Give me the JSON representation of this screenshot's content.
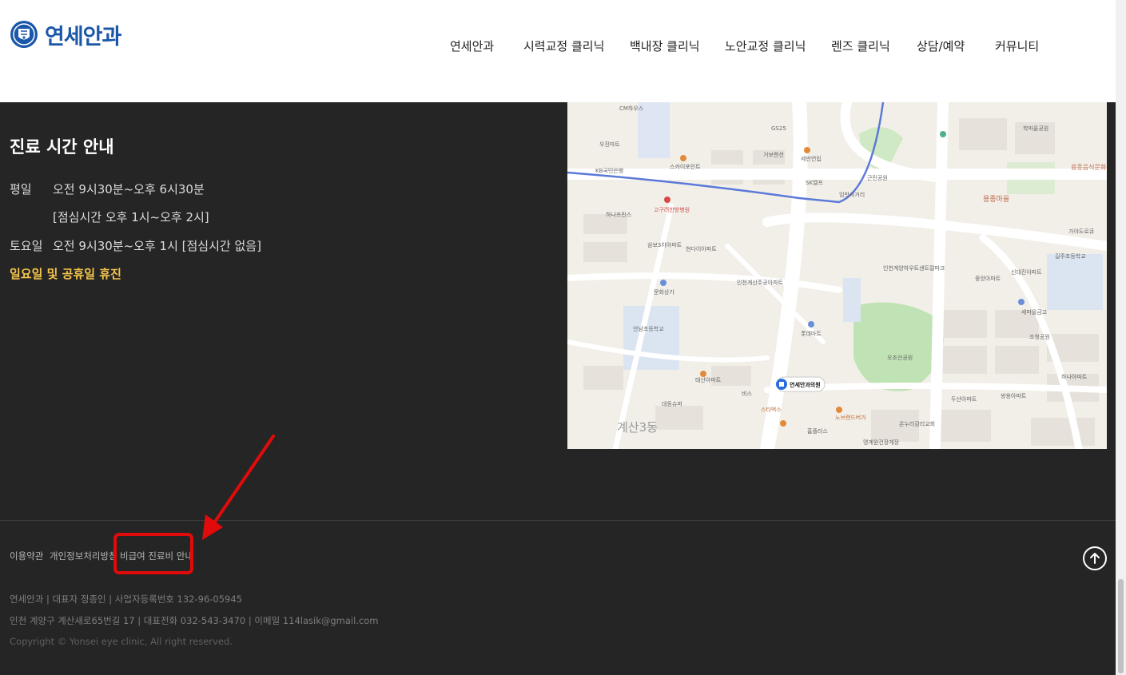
{
  "header": {
    "logo_text": "연세안과",
    "nav": [
      "연세안과",
      "시력교정 클리닉",
      "백내장 클리닉",
      "노안교정 클리닉",
      "렌즈 클리닉",
      "상담/예약",
      "커뮤니티"
    ]
  },
  "hours": {
    "title": "진료 시간 안내",
    "weekday_label": "평일",
    "weekday_time": "오전 9시30분~오후 6시30분",
    "lunch": "[점심시간  오후 1시~오후 2시]",
    "saturday_label": "토요일",
    "saturday_time": "오전 9시30분~오후 1시 [점심시간 없음]",
    "closed": "일요일 및 공휴일 휴진"
  },
  "map": {
    "marker_label": "연세안과의원",
    "labels": [
      "CM하우스",
      "GS25",
      "우진마트",
      "KB국민은행",
      "스카이포인트",
      "거보랜션",
      "세만연립",
      "SK엘프",
      "임학사거리",
      "근린공원",
      "학마을공원",
      "용종마을",
      "용종음식문화시범거리",
      "고구려한방병원",
      "하나프린스",
      "삼보3차아파트",
      "현다이아파트",
      "인천계산주공아파트",
      "문화상가",
      "안남초등학교",
      "인천계양하우트센트럴파크",
      "중앙아파트",
      "신대진아파트",
      "길주초등학교",
      "롯데마트",
      "오조산공원",
      "두산아파트",
      "쌍용아파트",
      "하나아파트",
      "태산아파트",
      "대동슈퍼",
      "노브랜드버거",
      "온누리감리교회",
      "스타벅스",
      "계산3동",
      "홈플러스",
      "명계원건장게장",
      "가야도로큐",
      "세마을금고",
      "조청공원",
      "비스"
    ]
  },
  "footer": {
    "links": [
      "이용약관",
      "개인정보처리방침",
      "비급여 진료비 안내"
    ],
    "company_line": "연세안과 | 대표자 정종인 | 사업자등록번호 132-96-05945",
    "address_line": "인천 계양구 계산새로65번길 17  |  대표전화 032-543-3470  |  이메일 114lasik@gmail.com",
    "copyright": "Copyright © Yonsei eye clinic, All right reserved."
  },
  "colors": {
    "brand": "#1a57a8",
    "footer_bg": "#252525",
    "closed_text": "#f4c54a",
    "annotation_red": "#e10b0b"
  }
}
